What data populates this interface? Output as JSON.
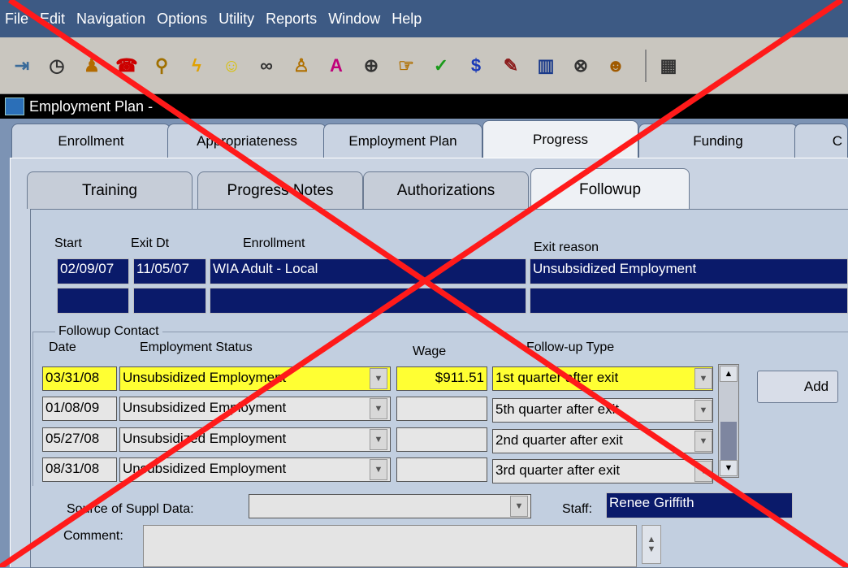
{
  "menu": [
    "File",
    "Edit",
    "Navigation",
    "Options",
    "Utility",
    "Reports",
    "Window",
    "Help"
  ],
  "toolbar_icons": [
    "exit-icon",
    "clock-icon",
    "people-icon",
    "phone-icon",
    "person-search-icon",
    "lightning-icon",
    "smiley-icon",
    "binoculars-icon",
    "person-icon",
    "grade-icon",
    "search-jd-icon",
    "hand-pointer-icon",
    "checkmark-icon",
    "dollar-icon",
    "edit-icon",
    "books-icon",
    "search-cm-icon",
    "face-icon",
    "calendar-icon"
  ],
  "window": {
    "title": "Employment Plan -"
  },
  "outer_tabs": [
    "Enrollment",
    "Appropriateness",
    "Employment Plan",
    "Progress",
    "Funding",
    "C"
  ],
  "inner_tabs": [
    "Training",
    "Progress Notes",
    "Authorizations",
    "Followup"
  ],
  "enrollment": {
    "headers": {
      "start": "Start",
      "exit_dt": "Exit Dt",
      "enrollment": "Enrollment",
      "exit_reason": "Exit reason"
    },
    "row": {
      "start": "02/09/07",
      "exit_dt": "11/05/07",
      "enrollment": "WIA Adult - Local",
      "exit_reason": "Unsubsidized Employment"
    }
  },
  "followup": {
    "group_label": "Followup Contact",
    "headers": {
      "date": "Date",
      "status": "Employment Status",
      "wage": "Wage",
      "type": "Follow-up Type"
    },
    "rows": [
      {
        "date": "03/31/08",
        "status": "Unsubsidized Employment",
        "wage": "$911.51",
        "type": "1st quarter after exit"
      },
      {
        "date": "01/08/09",
        "status": "Unsubsidized Employment",
        "wage": "",
        "type": "5th  quarter after exit"
      },
      {
        "date": "05/27/08",
        "status": "Unsubsidized Employment",
        "wage": "",
        "type": "2nd quarter after exit"
      },
      {
        "date": "08/31/08",
        "status": "Unsubsidized Employment",
        "wage": "",
        "type": "3rd quarter after exit"
      }
    ],
    "add_label": "Add"
  },
  "source": {
    "label": "Source of Suppl Data:",
    "value": ""
  },
  "staff": {
    "label": "Staff:",
    "value": "Renee Griffith"
  },
  "comment": {
    "label": "Comment:",
    "value": ""
  },
  "colors": {
    "cross": "#ff1a1a",
    "selected_field": "#0a1a6a",
    "highlight": "#ffff33"
  }
}
